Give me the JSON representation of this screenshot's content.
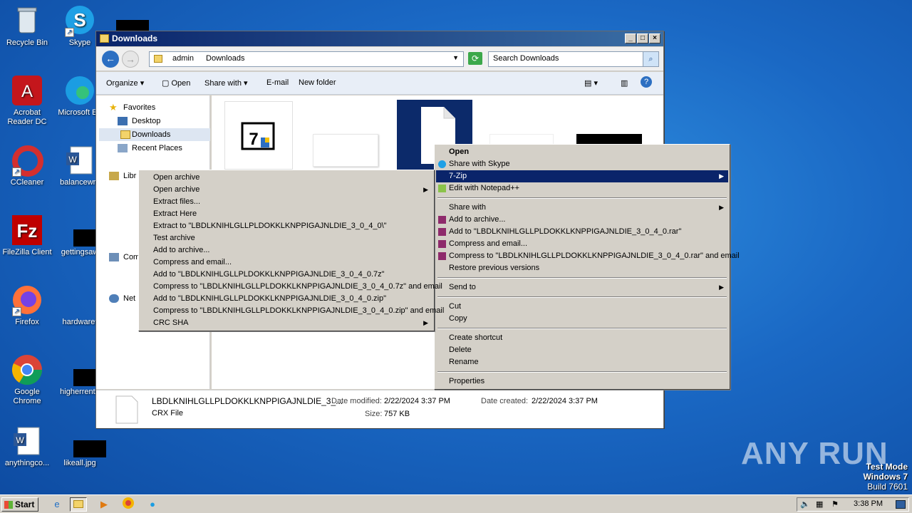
{
  "desktop": {
    "icons": [
      {
        "label": "Recycle Bin"
      },
      {
        "label": "Skype"
      },
      {
        "label": "Acrobat Reader DC"
      },
      {
        "label": "Microsoft Ed"
      },
      {
        "label": "CCleaner"
      },
      {
        "label": "balancewrit"
      },
      {
        "label": "FileZilla Client"
      },
      {
        "label": "gettingsaw"
      },
      {
        "label": "Firefox"
      },
      {
        "label": "hardwaret"
      },
      {
        "label": "Google Chrome"
      },
      {
        "label": "higherrenta"
      },
      {
        "label": "anythingco..."
      },
      {
        "label": "likeall.jpg"
      }
    ]
  },
  "window": {
    "title": "Downloads",
    "address": {
      "crumb1": "admin",
      "crumb2": "Downloads"
    },
    "search_placeholder": "Search Downloads",
    "toolbar": {
      "organize": "Organize",
      "open": "Open",
      "share": "Share with",
      "email": "E-mail",
      "newfolder": "New folder"
    },
    "nav": {
      "favorites": "Favorites",
      "desktop": "Desktop",
      "downloads": "Downloads",
      "recent": "Recent Places",
      "libraries": "Libr",
      "computer": "Com",
      "network": "Net"
    },
    "details": {
      "filename": "LBDLKNIHLGLLPLDOKKLKNPPIGAJNLDIE_3_...",
      "type": "CRX File",
      "modified_label": "Date modified:",
      "modified": "2/22/2024 3:37 PM",
      "created_label": "Date created:",
      "created": "2/22/2024 3:37 PM",
      "size_label": "Size:",
      "size": "757 KB"
    }
  },
  "context_menu": {
    "items": [
      "Open",
      "Share with Skype",
      "7-Zip",
      "Edit with Notepad++",
      "Share with",
      "Add to archive...",
      "Add to \"LBDLKNIHLGLLPLDOKKLKNPPIGAJNLDIE_3_0_4_0.rar\"",
      "Compress and email...",
      "Compress to \"LBDLKNIHLGLLPLDOKKLKNPPIGAJNLDIE_3_0_4_0.rar\" and email",
      "Restore previous versions",
      "Send to",
      "Cut",
      "Copy",
      "Create shortcut",
      "Delete",
      "Rename",
      "Properties"
    ]
  },
  "zip_menu": {
    "items": [
      "Open archive",
      "Open archive",
      "Extract files...",
      "Extract Here",
      "Extract to \"LBDLKNIHLGLLPLDOKKLKNPPIGAJNLDIE_3_0_4_0\\\"",
      "Test archive",
      "Add to archive...",
      "Compress and email...",
      "Add to \"LBDLKNIHLGLLPLDOKKLKNPPIGAJNLDIE_3_0_4_0.7z\"",
      "Compress to \"LBDLKNIHLGLLPLDOKKLKNPPIGAJNLDIE_3_0_4_0.7z\" and email",
      "Add to \"LBDLKNIHLGLLPLDOKKLKNPPIGAJNLDIE_3_0_4_0.zip\"",
      "Compress to \"LBDLKNIHLGLLPLDOKKLKNPPIGAJNLDIE_3_0_4_0.zip\" and email",
      "CRC SHA"
    ]
  },
  "taskbar": {
    "start": "Start",
    "clock": "3:38 PM"
  },
  "watermark": "ANY RUN",
  "testmode": {
    "line1": "Test Mode",
    "line2": "Windows 7",
    "line3": "Build 7601"
  }
}
